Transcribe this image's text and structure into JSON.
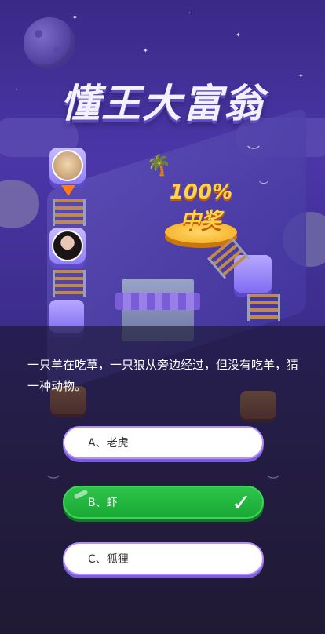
{
  "game": {
    "title": "懂王大富翁",
    "prize_label": "100%中奖"
  },
  "quiz": {
    "question": "一只羊在吃草，一只狼从旁边经过，但没有吃羊，猜一种动物。",
    "options": [
      {
        "label": "A、老虎",
        "state": "normal"
      },
      {
        "label": "B、虾",
        "state": "correct"
      },
      {
        "label": "C、狐狸",
        "state": "normal"
      }
    ],
    "correct_mark": "✓"
  },
  "colors": {
    "accent_purple": "#b68cff",
    "correct_green": "#1fb83d",
    "prize_gold": "#ffd34a"
  },
  "icons": [
    "cat-avatar-icon",
    "girl-avatar-icon",
    "arrow-down-icon",
    "checkmark-icon",
    "palm-tree-icon",
    "treasure-chest-icon",
    "bird-icon",
    "moon-icon"
  ]
}
